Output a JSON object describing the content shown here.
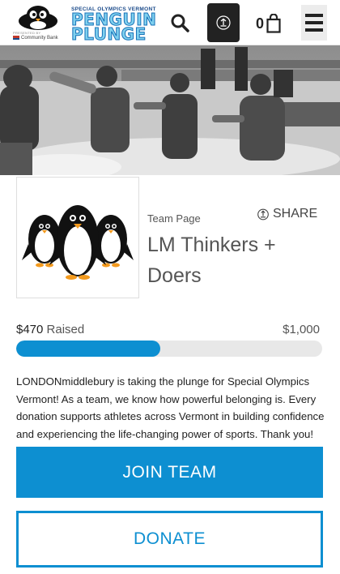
{
  "header": {
    "logo": {
      "tagline": "SPECIAL OLYMPICS VERMONT",
      "title_line1": "PENGUIN",
      "title_line2": "PLUNGE",
      "presented_by": "PRESENTED BY",
      "sponsor": "Community Bank",
      "icon": "penguin-mascot-icon"
    },
    "search_icon": "search-icon",
    "upload_icon": "upload-icon",
    "cart": {
      "count": "0",
      "icon": "shopping-bag-icon"
    },
    "menu_icon": "hamburger-menu-icon"
  },
  "hero": {
    "description_icon": "photo-banner"
  },
  "team": {
    "label": "Team Page",
    "share_label": "SHARE",
    "name": "LM Thinkers + Doers",
    "logo_icon": "three-penguins-icon"
  },
  "progress": {
    "raised_amount": "$470",
    "raised_label": "Raised",
    "goal": "$1,000",
    "fraction": 0.47
  },
  "description": "LONDONmiddlebury is taking the plunge for Special Olympics Vermont! As a team, we know how powerful belonging is. Every donation supports athletes across Vermont in building confidence and experiencing the life-changing power of sports. Thank you!",
  "actions": {
    "join_label": "JOIN TEAM",
    "donate_label": "DONATE"
  },
  "colors": {
    "accent": "#0d8fd1",
    "logo_light": "#7fd0ee",
    "logo_dark": "#1571b8"
  }
}
